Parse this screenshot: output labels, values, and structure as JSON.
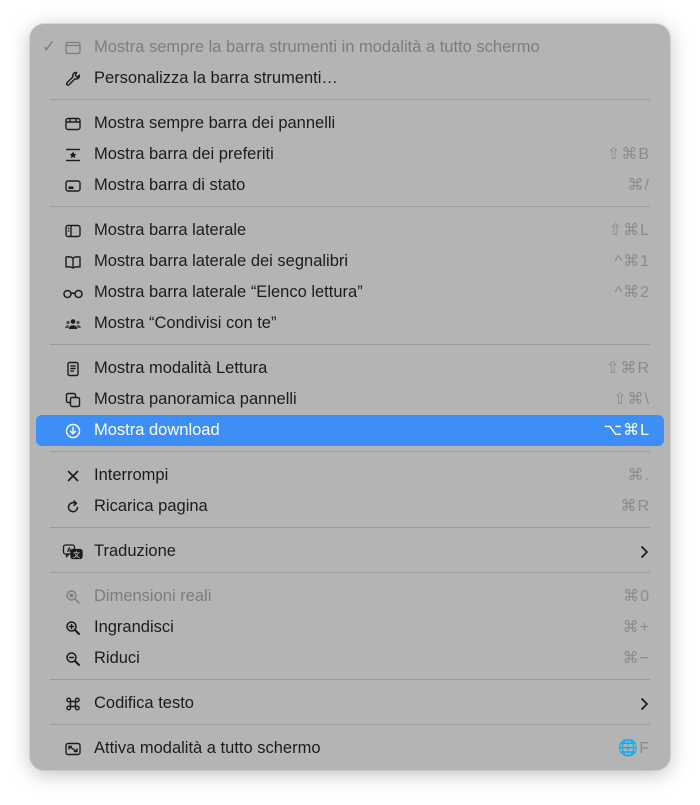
{
  "menu": {
    "items": [
      {
        "id": "always-show-toolbar-fullscreen",
        "label": "Mostra sempre la barra strumenti in modalità a tutto schermo",
        "shortcut": "",
        "checked": true,
        "disabled": true,
        "icon": "window-icon"
      },
      {
        "id": "customize-toolbar",
        "label": "Personalizza la barra strumenti…",
        "shortcut": "",
        "icon": "wrench-icon"
      },
      {
        "id": "always-show-tab-bar",
        "label": "Mostra sempre barra dei pannelli",
        "shortcut": "",
        "icon": "tab-bar-icon"
      },
      {
        "id": "show-favorites-bar",
        "label": "Mostra barra dei preferiti",
        "shortcut": "⇧⌘B",
        "icon": "favorites-bar-icon"
      },
      {
        "id": "show-status-bar",
        "label": "Mostra barra di stato",
        "shortcut": "⌘/",
        "icon": "status-bar-icon"
      },
      {
        "id": "show-sidebar",
        "label": "Mostra barra laterale",
        "shortcut": "⇧⌘L",
        "icon": "sidebar-icon"
      },
      {
        "id": "show-bookmarks-sidebar",
        "label": "Mostra barra laterale dei segnalibri",
        "shortcut": "^⌘1",
        "icon": "book-icon"
      },
      {
        "id": "show-reading-list-sidebar",
        "label": "Mostra barra laterale “Elenco lettura”",
        "shortcut": "^⌘2",
        "icon": "glasses-icon"
      },
      {
        "id": "show-shared-with-you",
        "label": "Mostra “Condivisi con te”",
        "shortcut": "",
        "icon": "people-icon"
      },
      {
        "id": "show-reader",
        "label": "Mostra modalità Lettura",
        "shortcut": "⇧⌘R",
        "icon": "reader-icon"
      },
      {
        "id": "show-tab-overview",
        "label": "Mostra panoramica pannelli",
        "shortcut": "⇧⌘\\",
        "icon": "tab-overview-icon"
      },
      {
        "id": "show-downloads",
        "label": "Mostra download",
        "shortcut": "⌥⌘L",
        "highlighted": true,
        "icon": "download-icon"
      },
      {
        "id": "stop",
        "label": "Interrompi",
        "shortcut": "⌘.",
        "icon": "close-icon"
      },
      {
        "id": "reload-page",
        "label": "Ricarica pagina",
        "shortcut": "⌘R",
        "icon": "reload-icon"
      },
      {
        "id": "translation",
        "label": "Traduzione",
        "submenu": true,
        "icon": "translate-icon"
      },
      {
        "id": "actual-size",
        "label": "Dimensioni reali",
        "shortcut": "⌘0",
        "disabled": true,
        "icon": "zoom-actual-icon"
      },
      {
        "id": "zoom-in",
        "label": "Ingrandisci",
        "shortcut": "⌘+",
        "icon": "zoom-in-icon"
      },
      {
        "id": "zoom-out",
        "label": "Riduci",
        "shortcut": "⌘−",
        "icon": "zoom-out-icon"
      },
      {
        "id": "text-encoding",
        "label": "Codifica testo",
        "submenu": true,
        "icon": "command-icon"
      },
      {
        "id": "enter-fullscreen",
        "label": "Attiva modalità a tutto schermo",
        "shortcut": "🌐F",
        "icon": "fullscreen-icon"
      }
    ]
  },
  "colors": {
    "menu_background": "#b4b4b4",
    "highlight": "#3d8ef7",
    "text": "#1c1c1c",
    "disabled_text": "#7d7d7d",
    "shortcut_text": "#8b8b8b"
  }
}
